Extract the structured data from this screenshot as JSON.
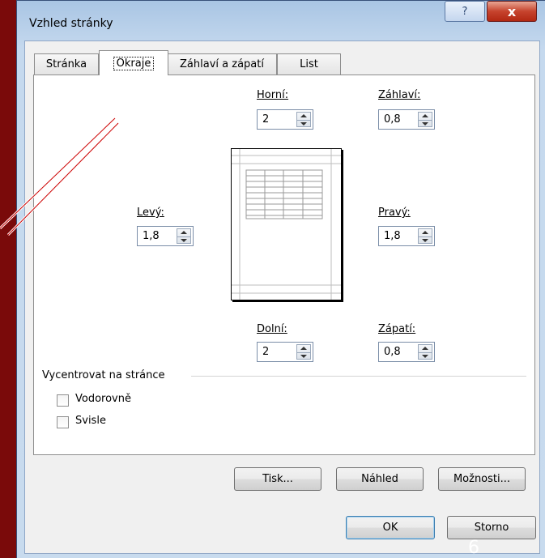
{
  "window": {
    "title": "Vzhled stránky",
    "help_glyph": "?",
    "close_glyph": "x"
  },
  "tabs": [
    {
      "label": "Stránka"
    },
    {
      "label": "Okraje"
    },
    {
      "label": "Záhlaví a zápatí"
    },
    {
      "label": "List"
    }
  ],
  "margins": {
    "top": {
      "label": "Horní:",
      "value": "2"
    },
    "header": {
      "label": "Záhlaví:",
      "value": "0,8"
    },
    "left": {
      "label": "Levý:",
      "value": "1,8"
    },
    "right": {
      "label": "Pravý:",
      "value": "1,8"
    },
    "bottom": {
      "label": "Dolní:",
      "value": "2"
    },
    "footer": {
      "label": "Zápatí:",
      "value": "0,8"
    }
  },
  "center": {
    "group_label": "Vycentrovat na stránce",
    "horizontal": {
      "label": "Vodorovně",
      "checked": false
    },
    "vertical": {
      "label": "Svisle",
      "checked": false
    }
  },
  "buttons": {
    "print": "Tisk...",
    "preview": "Náhled",
    "options": "Možnosti...",
    "ok": "OK",
    "cancel": "Storno"
  },
  "slide_number": "6"
}
